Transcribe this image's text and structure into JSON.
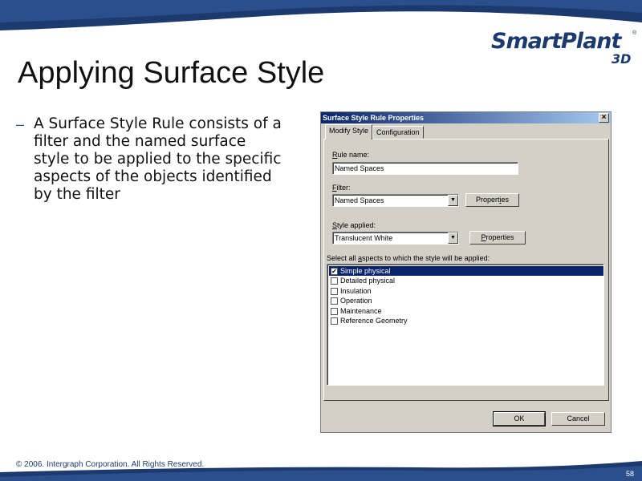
{
  "slide": {
    "title": "Applying Surface Style",
    "bullet_dash": "–",
    "bullet": "A Surface Style Rule consists of a filter and the named surface style to be applied to the specific aspects of the objects identified by the filter",
    "copyright": "© 2006. Intergraph Corporation. All Rights Reserved.",
    "page_number": "58"
  },
  "logo": {
    "main": "SmartPlant",
    "registered": "®",
    "sub": "3D"
  },
  "colors": {
    "brand_navy": "#1d3a6e",
    "band_blue": "#2b4f8c",
    "selection": "#0a246a"
  },
  "dialog": {
    "title": "Surface Style Rule Properties",
    "close_icon": "×",
    "tabs": [
      {
        "label": "Modify Style"
      },
      {
        "label": "Configuration"
      }
    ],
    "rule_name": {
      "label_pre": "",
      "label_u": "R",
      "label_post": "ule name:",
      "value": "Named Spaces"
    },
    "filter": {
      "label_pre": "",
      "label_u": "F",
      "label_post": "ilter:",
      "value": "Named Spaces",
      "button_pre": "Propert",
      "button_u": "i",
      "button_post": "es"
    },
    "style": {
      "label_pre": "",
      "label_u": "S",
      "label_post": "tyle applied:",
      "value": "Translucent White",
      "button_pre": "",
      "button_u": "P",
      "button_post": "roperties"
    },
    "aspects_label_pre": "Select all ",
    "aspects_label_u": "a",
    "aspects_label_post": "spects to which the style will be applied:",
    "aspects": [
      {
        "label": "Simple physical",
        "checked": "✔"
      },
      {
        "label": "Detailed physical",
        "checked": ""
      },
      {
        "label": "Insulation",
        "checked": ""
      },
      {
        "label": "Operation",
        "checked": ""
      },
      {
        "label": "Maintenance",
        "checked": ""
      },
      {
        "label": "Reference Geometry",
        "checked": ""
      }
    ],
    "ok_label": "OK",
    "cancel_label": "Cancel",
    "dropdown_icon": "▼"
  }
}
